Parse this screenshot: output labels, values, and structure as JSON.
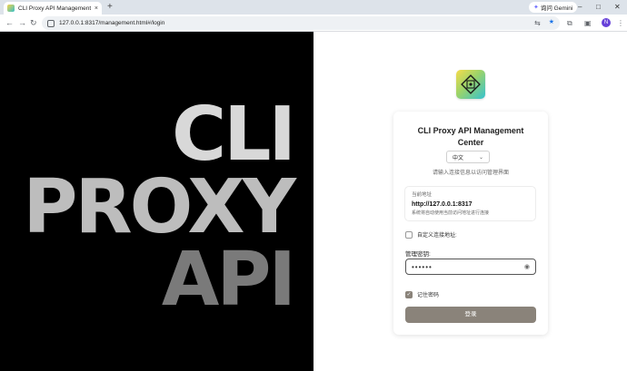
{
  "browser": {
    "tab_title": "CLI Proxy API Management C",
    "tab_close": "×",
    "new_tab": "+",
    "gemini_label": "询问 Gemini",
    "url": "127.0.0.1:8317/management.html#/login",
    "profile_initial": "N"
  },
  "hero": {
    "line1": "CLI",
    "line2": "PROXY",
    "line3": "API"
  },
  "login": {
    "title": "CLI Proxy API Management Center",
    "language": "中文",
    "subtitle": "请输入连接信息以访问管理界面",
    "current_address_label": "当前地址",
    "current_address": "http://127.0.0.1:8317",
    "address_hint": "系统将自动使用当前访问地址进行连接",
    "custom_address_label": "自定义连接地址:",
    "password_label": "管理密钥:",
    "password_mask": "••••••",
    "remember_label": "记住密码",
    "remember_checked": true,
    "login_button": "登录"
  },
  "colors": {
    "accent": "#8a837a",
    "hero_bg": "#000000"
  },
  "icons": [
    "favicon-icon",
    "close-icon",
    "back-icon",
    "forward-icon",
    "reload-icon",
    "site-info-icon",
    "translate-icon",
    "star-icon",
    "extensions-icon",
    "sidebar-icon",
    "eye-icon",
    "check-icon",
    "chevron-down-icon"
  ]
}
